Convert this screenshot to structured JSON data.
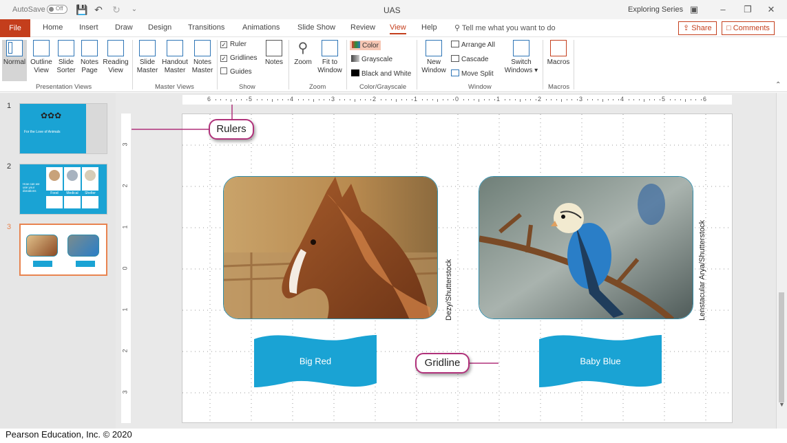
{
  "titlebar": {
    "autosave_label": "AutoSave",
    "autosave_state": "Off",
    "doc_title": "UAS",
    "series_label": "Exploring Series"
  },
  "tabs": [
    "File",
    "Home",
    "Insert",
    "Draw",
    "Design",
    "Transitions",
    "Animations",
    "Slide Show",
    "Review",
    "View",
    "Help"
  ],
  "active_tab": "View",
  "tell_me": "Tell me what you want to do",
  "share_label": "Share",
  "comments_label": "Comments",
  "ribbon": {
    "presentation_views": {
      "label": "Presentation Views",
      "buttons": [
        {
          "l1": "Normal",
          "l2": ""
        },
        {
          "l1": "Outline",
          "l2": "View"
        },
        {
          "l1": "Slide",
          "l2": "Sorter"
        },
        {
          "l1": "Notes",
          "l2": "Page"
        },
        {
          "l1": "Reading",
          "l2": "View"
        }
      ]
    },
    "master_views": {
      "label": "Master Views",
      "buttons": [
        {
          "l1": "Slide",
          "l2": "Master"
        },
        {
          "l1": "Handout",
          "l2": "Master"
        },
        {
          "l1": "Notes",
          "l2": "Master"
        }
      ]
    },
    "show": {
      "label": "Show",
      "ruler": "Ruler",
      "gridlines": "Gridlines",
      "guides": "Guides",
      "notes": "Notes"
    },
    "zoom": {
      "label": "Zoom",
      "zoom_btn": "Zoom",
      "fit_l1": "Fit to",
      "fit_l2": "Window"
    },
    "color": {
      "label": "Color/Grayscale",
      "color": "Color",
      "grayscale": "Grayscale",
      "bw": "Black and White"
    },
    "window": {
      "label": "Window",
      "new_l1": "New",
      "new_l2": "Window",
      "arrange": "Arrange All",
      "cascade": "Cascade",
      "move_split": "Move Split",
      "switch_l1": "Switch",
      "switch_l2": "Windows"
    },
    "macros": {
      "label": "Macros",
      "btn": "Macros"
    }
  },
  "slides": [
    {
      "num": "1",
      "title": "For the Love of Animals"
    },
    {
      "num": "2",
      "title": "How can we use your donations",
      "items": [
        "Food",
        "Medical",
        "Shelter"
      ]
    },
    {
      "num": "3"
    }
  ],
  "hruler_ticks": [
    "6",
    "5",
    "4",
    "3",
    "2",
    "1",
    "0",
    "1",
    "2",
    "3",
    "4",
    "5",
    "6"
  ],
  "vruler_ticks": [
    "3",
    "2",
    "1",
    "0",
    "1",
    "2",
    "3"
  ],
  "slide": {
    "credit_left": "Dezy/Shutterstock",
    "credit_right": "Lenstacular Arya/Shutterstock",
    "banner_left": "Big Red",
    "banner_right": "Baby Blue"
  },
  "callouts": {
    "rulers": "Rulers",
    "gridline": "Gridline"
  },
  "footer": "Pearson Education, Inc. © 2020",
  "colors": {
    "accent": "#c43e1c",
    "banner": "#1aa3d4",
    "callout_border": "#b0317a",
    "ribbon_icon": "#2e75b6"
  }
}
